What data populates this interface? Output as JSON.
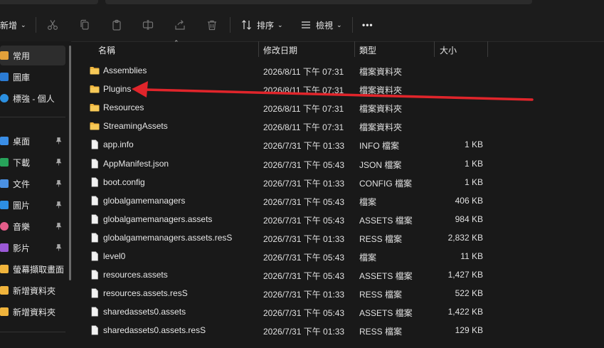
{
  "toolbar": {
    "new_label": "新增",
    "sort_label": "排序",
    "view_label": "檢視",
    "more_label": "•••"
  },
  "sidebar": {
    "items": [
      {
        "label": "常用",
        "icon": "home-icon",
        "color": "#e3a13a"
      },
      {
        "label": "圖庫",
        "icon": "gallery-icon",
        "color": "#2b7bd3"
      },
      {
        "label": "標強 - 個人",
        "icon": "cloud-icon",
        "color": "#2b8fe0"
      },
      {
        "label": "桌面",
        "icon": "desktop-icon",
        "color": "#3a8ee6"
      },
      {
        "label": "下載",
        "icon": "download-icon",
        "color": "#27a35a"
      },
      {
        "label": "文件",
        "icon": "document-icon",
        "color": "#4a90e2"
      },
      {
        "label": "圖片",
        "icon": "pictures-icon",
        "color": "#2d8fe3"
      },
      {
        "label": "音樂",
        "icon": "music-icon",
        "color": "#e35d8a"
      },
      {
        "label": "影片",
        "icon": "video-icon",
        "color": "#9b59d6"
      },
      {
        "label": "螢幕擷取畫面",
        "icon": "folder-icon",
        "color": "#f0b43c"
      },
      {
        "label": "新增資料夾",
        "icon": "folder-icon",
        "color": "#f0b43c"
      },
      {
        "label": "新增資料夾",
        "icon": "folder-icon",
        "color": "#f0b43c"
      }
    ]
  },
  "columns": {
    "name": "名稱",
    "modified": "修改日期",
    "type": "類型",
    "size": "大小"
  },
  "files": [
    {
      "name": "Assemblies",
      "modified": "2026/8/11 下午 07:31",
      "type": "檔案資料夾",
      "size": "",
      "kind": "folder"
    },
    {
      "name": "Plugins",
      "modified": "2026/8/11 下午 07:31",
      "type": "檔案資料夾",
      "size": "",
      "kind": "folder"
    },
    {
      "name": "Resources",
      "modified": "2026/8/11 下午 07:31",
      "type": "檔案資料夾",
      "size": "",
      "kind": "folder"
    },
    {
      "name": "StreamingAssets",
      "modified": "2026/8/11 下午 07:31",
      "type": "檔案資料夾",
      "size": "",
      "kind": "folder"
    },
    {
      "name": "app.info",
      "modified": "2026/7/31 下午 01:33",
      "type": "INFO 檔案",
      "size": "1 KB",
      "kind": "file"
    },
    {
      "name": "AppManifest.json",
      "modified": "2026/7/31 下午 05:43",
      "type": "JSON 檔案",
      "size": "1 KB",
      "kind": "file"
    },
    {
      "name": "boot.config",
      "modified": "2026/7/31 下午 01:33",
      "type": "CONFIG 檔案",
      "size": "1 KB",
      "kind": "file"
    },
    {
      "name": "globalgamemanagers",
      "modified": "2026/7/31 下午 05:43",
      "type": "檔案",
      "size": "406 KB",
      "kind": "file"
    },
    {
      "name": "globalgamemanagers.assets",
      "modified": "2026/7/31 下午 05:43",
      "type": "ASSETS 檔案",
      "size": "984 KB",
      "kind": "file"
    },
    {
      "name": "globalgamemanagers.assets.resS",
      "modified": "2026/7/31 下午 01:33",
      "type": "RESS 檔案",
      "size": "2,832 KB",
      "kind": "file"
    },
    {
      "name": "level0",
      "modified": "2026/7/31 下午 05:43",
      "type": "檔案",
      "size": "11 KB",
      "kind": "file"
    },
    {
      "name": "resources.assets",
      "modified": "2026/7/31 下午 05:43",
      "type": "ASSETS 檔案",
      "size": "1,427 KB",
      "kind": "file"
    },
    {
      "name": "resources.assets.resS",
      "modified": "2026/7/31 下午 01:33",
      "type": "RESS 檔案",
      "size": "522 KB",
      "kind": "file"
    },
    {
      "name": "sharedassets0.assets",
      "modified": "2026/7/31 下午 05:43",
      "type": "ASSETS 檔案",
      "size": "1,422 KB",
      "kind": "file"
    },
    {
      "name": "sharedassets0.assets.resS",
      "modified": "2026/7/31 下午 01:33",
      "type": "RESS 檔案",
      "size": "129 KB",
      "kind": "file"
    }
  ],
  "colors": {
    "background": "#191919",
    "folder": "#f0b43c",
    "arrow": "#e0252b"
  }
}
